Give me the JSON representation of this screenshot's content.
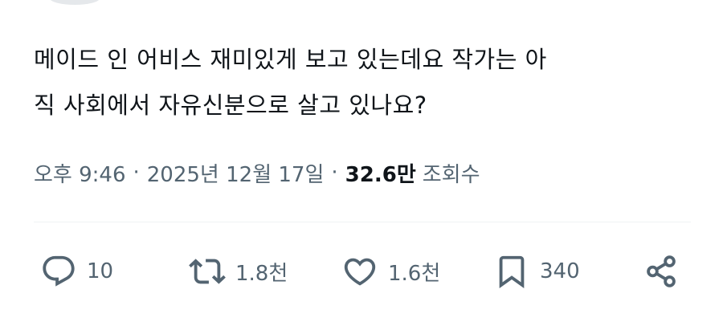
{
  "tweet": {
    "text_line1": "메이드 인 어비스 재미있게 보고 있는데요 작가는 아",
    "text_line2": "직 사회에서 자유신분으로 살고 있나요?",
    "time": "오후 9:46",
    "separator": "·",
    "date": "2025년 12월 17일",
    "views_count": "32.6만",
    "views_label": "조회수"
  },
  "actions": {
    "replies": {
      "icon": "reply-icon",
      "count": "10"
    },
    "retweets": {
      "icon": "retweet-icon",
      "count": "1.8천"
    },
    "likes": {
      "icon": "heart-icon",
      "count": "1.6천"
    },
    "bookmarks": {
      "icon": "bookmark-icon",
      "count": "340"
    },
    "share": {
      "icon": "share-icon"
    }
  },
  "colors": {
    "text": "#0f1419",
    "secondary": "#536471",
    "divider": "#eff3f4"
  }
}
